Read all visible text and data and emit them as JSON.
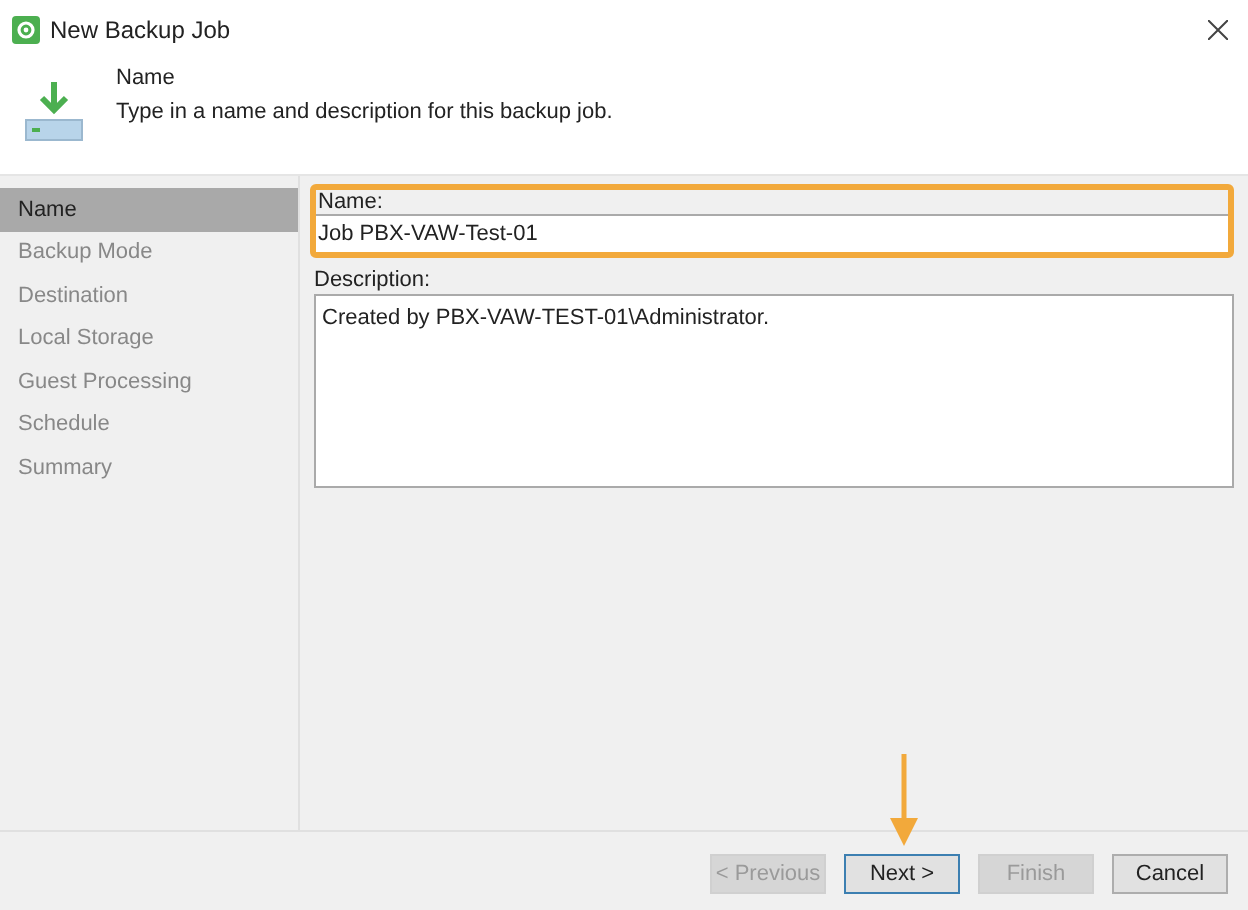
{
  "window": {
    "title": "New Backup Job"
  },
  "header": {
    "title": "Name",
    "description": "Type in a name and description for this backup job."
  },
  "steps": [
    {
      "label": "Name",
      "selected": true
    },
    {
      "label": "Backup Mode",
      "selected": false
    },
    {
      "label": "Destination",
      "selected": false
    },
    {
      "label": "Local Storage",
      "selected": false
    },
    {
      "label": "Guest Processing",
      "selected": false
    },
    {
      "label": "Schedule",
      "selected": false
    },
    {
      "label": "Summary",
      "selected": false
    }
  ],
  "name_field": {
    "label": "Name:",
    "value": "Job PBX-VAW-Test-01",
    "highlighted": true
  },
  "description_field": {
    "label": "Description:",
    "value": "Created by PBX-VAW-TEST-01\\Administrator."
  },
  "buttons": [
    {
      "label": "< Previous",
      "disabled": true,
      "focused": false,
      "pointed": false
    },
    {
      "label": "Next >",
      "disabled": false,
      "focused": true,
      "pointed": true
    },
    {
      "label": "Finish",
      "disabled": true,
      "focused": false,
      "pointed": false
    },
    {
      "label": "Cancel",
      "disabled": false,
      "focused": false,
      "pointed": false
    }
  ]
}
